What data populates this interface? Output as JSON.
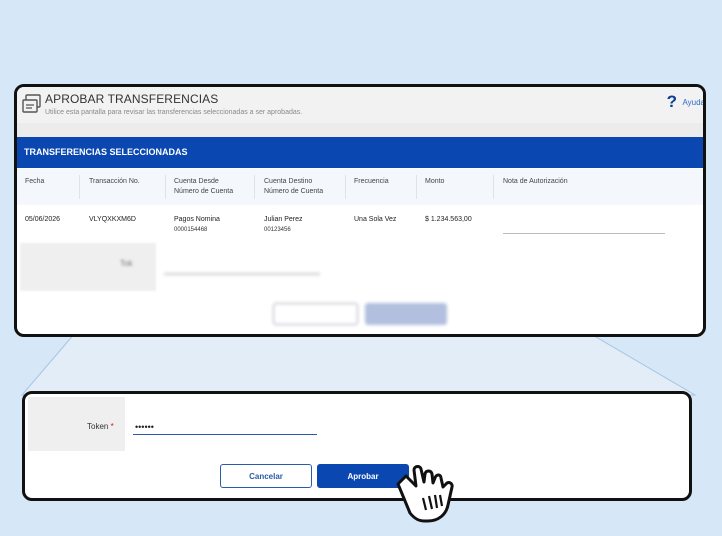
{
  "header": {
    "title": "APROBAR TRANSFERENCIAS",
    "subtitle": "Utilice esta pantalla para revisar las transferencias seleccionadas a ser aprobadas.",
    "help_label": "Ayuda",
    "help_icon": "question-mark-icon"
  },
  "section": {
    "title": "TRANSFERENCIAS SELECCIONADAS"
  },
  "table": {
    "columns": [
      {
        "label": "Fecha",
        "sub": ""
      },
      {
        "label": "Transacción No.",
        "sub": ""
      },
      {
        "label": "Cuenta Desde",
        "sub": "Número de Cuenta"
      },
      {
        "label": "Cuenta Destino",
        "sub": "Número de Cuenta"
      },
      {
        "label": "Frecuencia",
        "sub": ""
      },
      {
        "label": "Monto",
        "sub": ""
      },
      {
        "label": "Nota de Autorización",
        "sub": ""
      }
    ],
    "rows": [
      {
        "fecha": "05/06/2026",
        "transaccion": "VLYQXKXM6D",
        "cuenta_desde": "Pagos Nomina",
        "cuenta_desde_num": "0000154468",
        "cuenta_destino": "Julian Perez",
        "cuenta_destino_num": "00123456",
        "frecuencia": "Una Sola Vez",
        "monto": "$ 1.234.563,00",
        "nota": ""
      }
    ]
  },
  "blurred": {
    "token_label": "Tok",
    "cancel": "Cancelar",
    "approve": "Aprobar"
  },
  "zoom": {
    "token_label": "Token",
    "required_mark": "*",
    "token_value": "••••••",
    "cancel_label": "Cancelar",
    "approve_label": "Aprobar"
  },
  "colors": {
    "brand_blue": "#0a47b0",
    "background": "#d6e7f7"
  }
}
